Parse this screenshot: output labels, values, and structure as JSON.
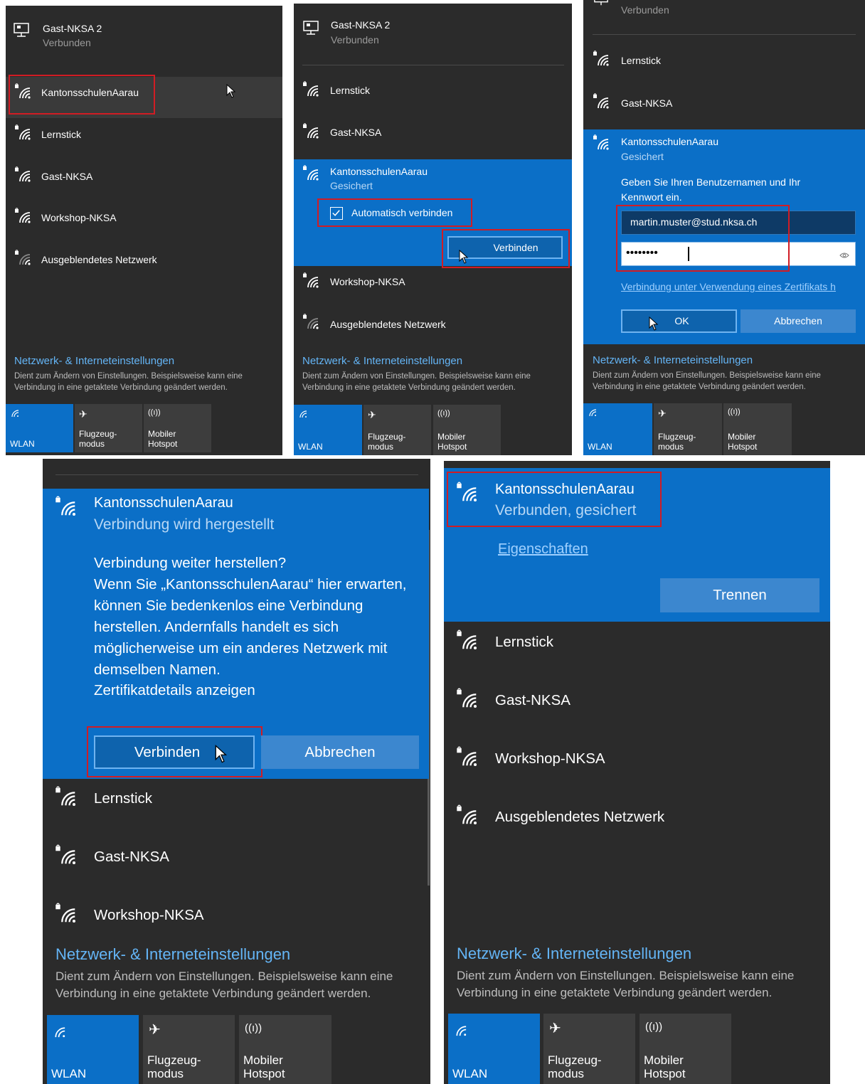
{
  "networks": {
    "gast2": "Gast-NKSA 2",
    "kantons": "KantonsschulenAarau",
    "lernstick": "Lernstick",
    "gast": "Gast-NKSA",
    "workshop": "Workshop-NKSA",
    "hidden": "Ausgeblendetes Netzwerk"
  },
  "status": {
    "verbunden": "Verbunden",
    "gesichert": "Gesichert",
    "verbindung_wird": "Verbindung wird hergestellt",
    "verbunden_gesichert": "Verbunden, gesichert"
  },
  "panel2": {
    "auto_connect": "Automatisch verbinden",
    "connect_button": "Verbinden",
    "auto_connect_checked": true
  },
  "panel3": {
    "prompt": "Geben Sie Ihren Benutzernamen und Ihr Kennwort ein.",
    "username_value": "martin.muster@stud.nksa.ch",
    "password_mask": "••••••••",
    "cert_link": "Verbindung unter Verwendung eines Zertifikats h",
    "ok_button": "OK",
    "cancel_button": "Abbrechen"
  },
  "panel4": {
    "question": "Verbindung weiter herstellen?",
    "body": "Wenn Sie „KantonsschulenAarau“ hier erwarten, können Sie bedenkenlos eine Verbindung herstellen. Andernfalls handelt es sich möglicherweise um ein anderes Netzwerk mit demselben Namen.",
    "cert_details": "Zertifikatdetails anzeigen",
    "connect_button": "Verbinden",
    "cancel_button": "Abbrechen"
  },
  "panel5": {
    "properties_link": "Eigenschaften",
    "disconnect_button": "Trennen"
  },
  "settings": {
    "title": "Netzwerk- & Interneteinstellungen",
    "desc": "Dient zum Ändern von Einstellungen. Beispielsweise kann eine Verbindung in eine getaktete Verbindung geändert werden."
  },
  "tiles": {
    "wlan": "WLAN",
    "flight": "Flugzeug-\nmodus",
    "hotspot": "Mobiler\nHotspot"
  },
  "colors": {
    "panel_bg": "#2b2b2b",
    "selected_blue": "#0b6fc7",
    "highlight_red": "#d11c24",
    "link_blue": "#64b5f6"
  },
  "icons": {
    "wifi_secured": "wifi-lock-icon",
    "ethernet": "ethernet-icon",
    "airplane": "airplane-icon",
    "hotspot": "hotspot-icon",
    "eye": "eye-icon",
    "cursor": "mouse-cursor-icon"
  }
}
